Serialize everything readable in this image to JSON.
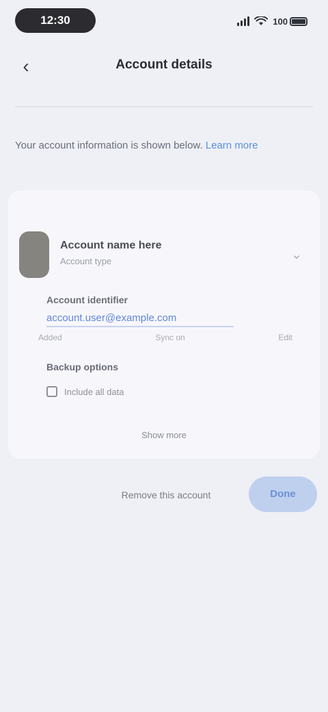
{
  "status_bar": {
    "time": "12:30",
    "battery_percent": "100",
    "battery_level": 1.0
  },
  "nav": {
    "back_icon": "back-arrow-icon",
    "title": "Account details"
  },
  "info": {
    "text": "Your account information is shown below. ",
    "link": "Learn more"
  },
  "account": {
    "name": "Account name here",
    "subtitle": "Account type",
    "chevron_icon": "chevron-down-icon"
  },
  "field_one": {
    "label": "Account identifier",
    "value": "account.user@example.com"
  },
  "meta": {
    "left": "Added",
    "center": "Sync on",
    "right": "Edit"
  },
  "field_two": {
    "label": "Backup options",
    "option": "Include all data"
  },
  "card_link": "Show more",
  "actions": {
    "secondary": "Remove this account",
    "primary": "Done"
  },
  "colors": {
    "background": "#eef0f5",
    "card": "#f7f7fb",
    "accent": "#5f86d8",
    "primary_button": "#bfd0ef"
  }
}
